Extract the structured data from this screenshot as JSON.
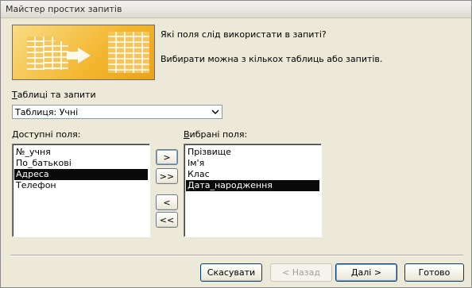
{
  "window": {
    "title": "Майстер простих запитів"
  },
  "prompts": {
    "question": "Які поля слід використати в запиті?",
    "hint": "Вибирати можна з кількох таблиць або запитів."
  },
  "tables": {
    "label_underlined": "Т",
    "label_rest": "аблиці та запити",
    "selected_value": "Таблиця: Учні"
  },
  "available": {
    "label_underlined": "Д",
    "label_rest": "оступні поля:",
    "items": [
      "№_учня",
      "По_батькові",
      "Адреса",
      "Телефон"
    ],
    "selected_index": 2
  },
  "selected": {
    "label_underlined": "В",
    "label_rest": "ибрані поля:",
    "items": [
      "Прізвище",
      "Ім'я",
      "Клас",
      "Дата_народження"
    ],
    "selected_index": 3
  },
  "move_buttons": {
    "add_one": ">",
    "add_all": ">>",
    "remove_one": "<",
    "remove_all": "<<"
  },
  "footer": {
    "cancel": "Скасувати",
    "back": "< Назад",
    "next": "Далі >",
    "finish": "Готово"
  },
  "icons": {
    "dropdown": "chevron-down-icon"
  }
}
